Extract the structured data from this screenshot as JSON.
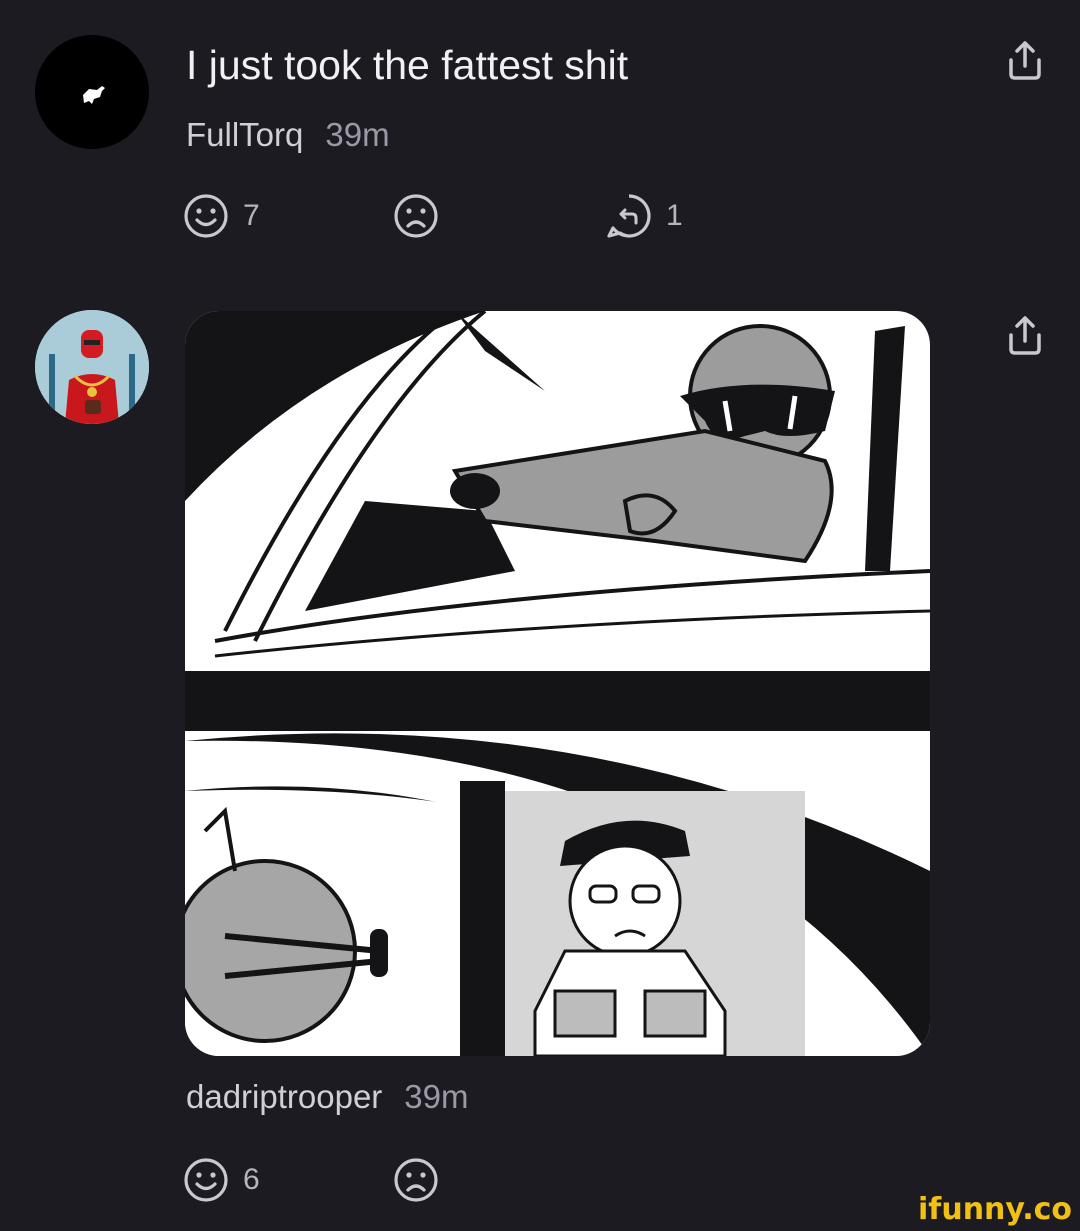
{
  "post": {
    "title": "I just took the fattest shit",
    "author": "FullTorq",
    "time": "39m",
    "smile_count": "7",
    "reply_count": "1",
    "avatar_icon": "pony-logo-icon"
  },
  "reply": {
    "author": "dadriptrooper",
    "time": "39m",
    "smile_count": "6",
    "avatar_icon": "red-trooper-avatar"
  },
  "watermark": "ifunny.co",
  "colors": {
    "background": "#1c1b22",
    "text": "#f1f1f4",
    "secondary": "#9a9aa6",
    "icon": "#c8c8d0",
    "watermark": "#f2c014"
  }
}
